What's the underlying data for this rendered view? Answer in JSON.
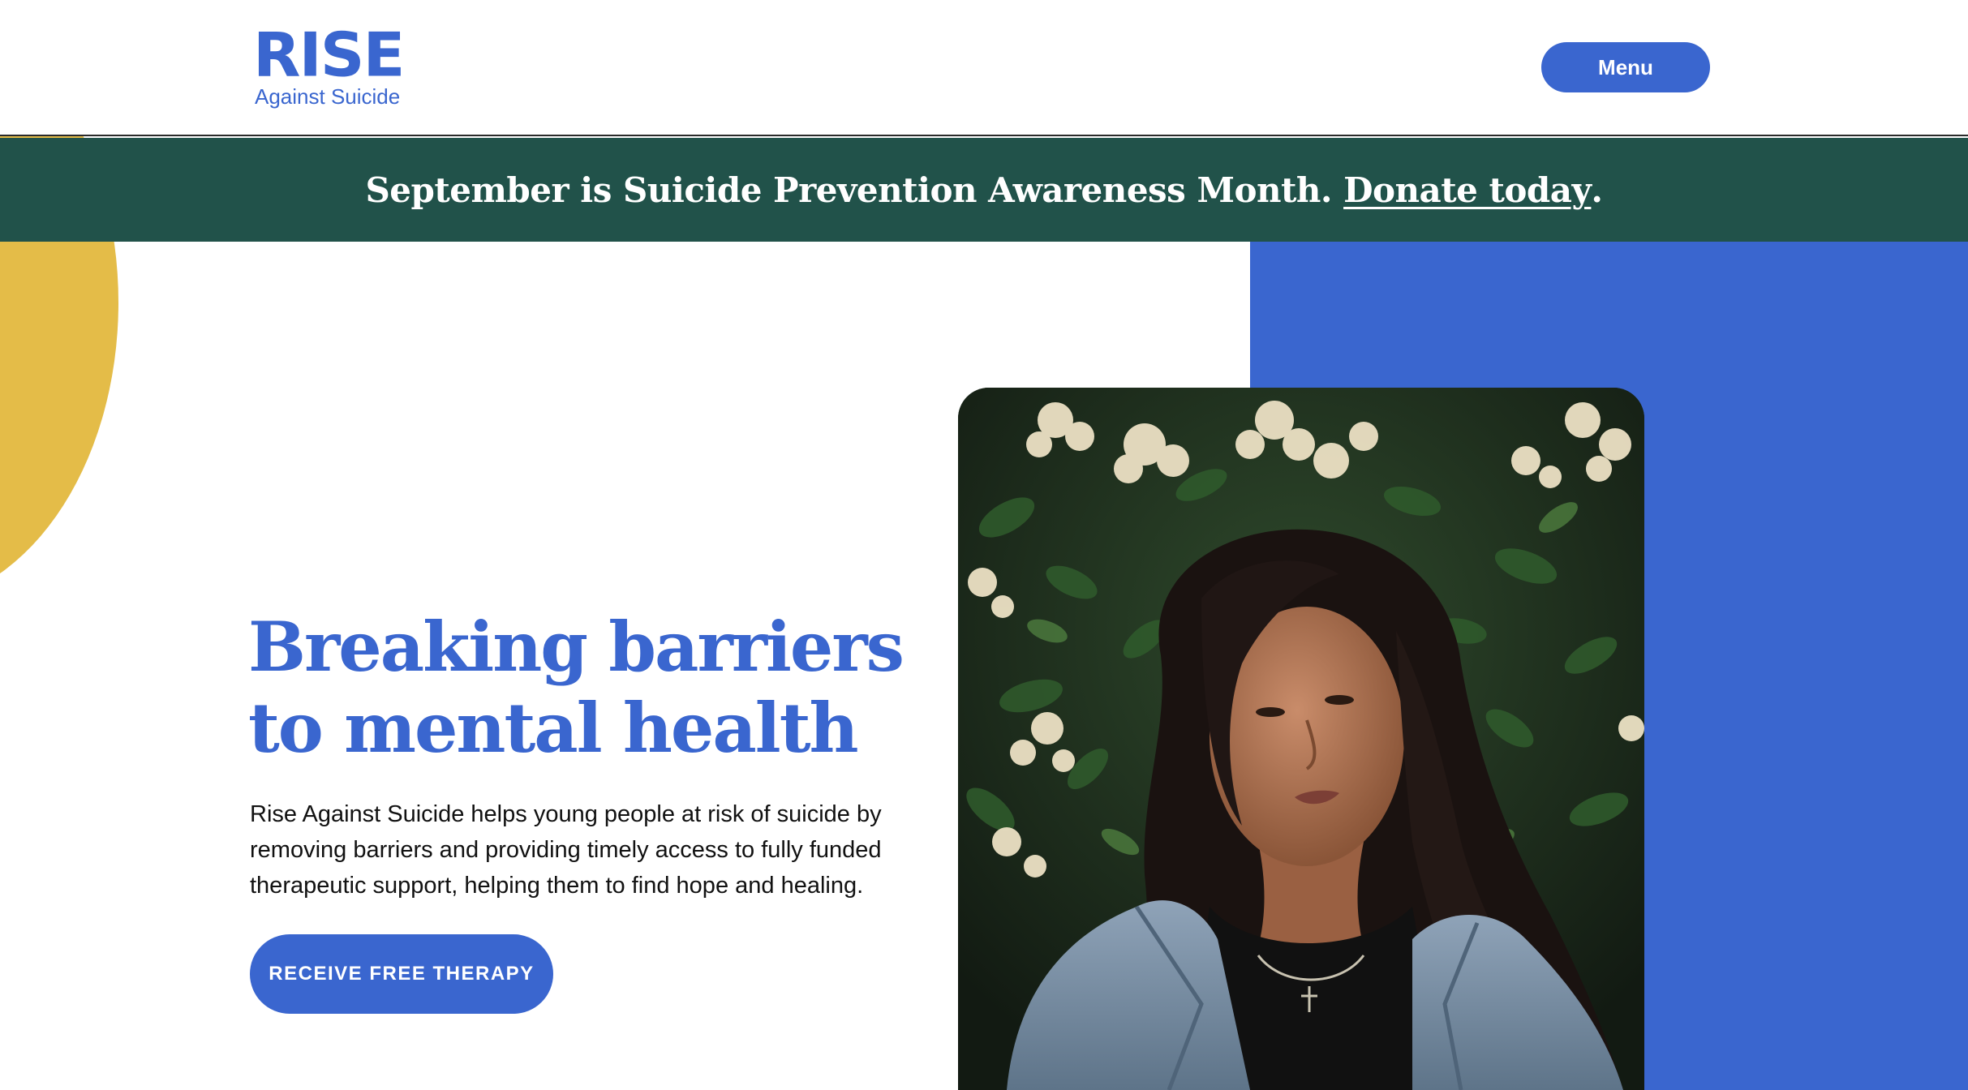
{
  "header": {
    "logo_word": "RISE",
    "logo_subtitle": "Against Suicide",
    "menu_label": "Menu"
  },
  "banner": {
    "text": "September is Suicide Prevention Awareness Month.",
    "link_text": "Donate today",
    "suffix": "."
  },
  "hero": {
    "title_line1": "Breaking barriers",
    "title_line2": "to mental health",
    "description_line1": "Rise Against Suicide helps young people at risk of suicide by",
    "description_line2": "removing barriers and providing timely access to fully funded",
    "description_line3": "therapeutic support, helping them to find hope and healing.",
    "cta_label": "RECEIVE FREE THERAPY"
  },
  "colors": {
    "brand_blue": "#3a66cf",
    "banner_green": "#21524a",
    "accent_yellow": "#e4bc48",
    "text_dark": "#111111"
  }
}
